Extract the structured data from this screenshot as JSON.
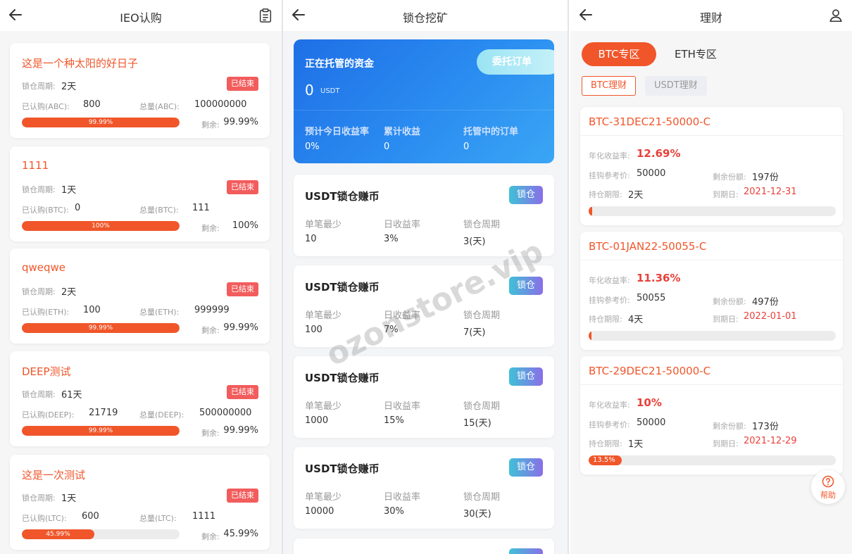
{
  "panel1": {
    "title": "IEO认购",
    "cards": [
      {
        "name": "这是一个种太阳的好日子",
        "period_label": "锁仓周期:",
        "period": "2天",
        "badge": "已结束",
        "subscribed_label": "已认购(ABC):",
        "subscribed": "800",
        "total_label": "总量(ABC):",
        "total": "100000000",
        "progress": 99.99,
        "progress_text": "99.99%",
        "remain_label": "剩余:",
        "remain": "99.99%"
      },
      {
        "name": "1111",
        "period_label": "锁仓周期:",
        "period": "1天",
        "badge": "已结束",
        "subscribed_label": "已认购(BTC):",
        "subscribed": "0",
        "total_label": "总量(BTC):",
        "total": "111",
        "progress": 100,
        "progress_text": "100%",
        "remain_label": "剩余:",
        "remain": "100%"
      },
      {
        "name": "qweqwe",
        "period_label": "锁仓周期:",
        "period": "2天",
        "badge": "已结束",
        "subscribed_label": "已认购(ETH):",
        "subscribed": "100",
        "total_label": "总量(ETH):",
        "total": "999999",
        "progress": 99.99,
        "progress_text": "99.99%",
        "remain_label": "剩余:",
        "remain": "99.99%"
      },
      {
        "name": "DEEP测试",
        "period_label": "锁仓周期:",
        "period": "61天",
        "badge": "已结束",
        "subscribed_label": "已认购(DEEP):",
        "subscribed": "21719",
        "total_label": "总量(DEEP):",
        "total": "500000000",
        "progress": 99.99,
        "progress_text": "99.99%",
        "remain_label": "剩余:",
        "remain": "99.99%"
      },
      {
        "name": "这是一次测试",
        "period_label": "锁仓周期:",
        "period": "1天",
        "badge": "已结束",
        "subscribed_label": "已认购(LTC):",
        "subscribed": "600",
        "total_label": "总量(LTC):",
        "total": "1111",
        "progress": 45.99,
        "progress_text": "45.99%",
        "remain_label": "剩余:",
        "remain": "45.99%"
      }
    ]
  },
  "panel2": {
    "title": "锁仓挖矿",
    "hero": {
      "label": "正在托管的资金",
      "amount": "0",
      "unit": "USDT",
      "entrust_button": "委托订单",
      "stats": [
        {
          "label": "预计今日收益率",
          "value": "0%"
        },
        {
          "label": "累计收益",
          "value": "0"
        },
        {
          "label": "托管中的订单",
          "value": "0"
        }
      ]
    },
    "cards": [
      {
        "title": "USDT锁仓赚币",
        "button": "锁仓",
        "min_label": "单笔最少",
        "min": "10",
        "rate_label": "日收益率",
        "rate": "3%",
        "period_label": "锁仓周期",
        "period": "3(天)"
      },
      {
        "title": "USDT锁仓赚币",
        "button": "锁仓",
        "min_label": "单笔最少",
        "min": "100",
        "rate_label": "日收益率",
        "rate": "7%",
        "period_label": "锁仓周期",
        "period": "7(天)"
      },
      {
        "title": "USDT锁仓赚币",
        "button": "锁仓",
        "min_label": "单笔最少",
        "min": "1000",
        "rate_label": "日收益率",
        "rate": "15%",
        "period_label": "锁仓周期",
        "period": "15(天)"
      },
      {
        "title": "USDT锁仓赚币",
        "button": "锁仓",
        "min_label": "单笔最少",
        "min": "10000",
        "rate_label": "日收益率",
        "rate": "30%",
        "period_label": "锁仓周期",
        "period": "30(天)"
      }
    ],
    "watermark": "ozonstore.vip"
  },
  "panel3": {
    "title": "理财",
    "zone_tabs": [
      "BTC专区",
      "ETH专区"
    ],
    "sub_tabs": [
      "BTC理财",
      "USDT理财"
    ],
    "cards": [
      {
        "title": "BTC-31DEC21-50000-C",
        "rate_label": "年化收益率:",
        "rate": "12.69%",
        "ref_label": "挂钩参考价:",
        "ref": "50000",
        "shares_label": "剩余份额:",
        "shares": "197份",
        "hold_label": "持仓期限:",
        "hold": "2天",
        "due_label": "到期日:",
        "due": "2021-12-31",
        "progress": 1.5,
        "progress_text": ""
      },
      {
        "title": "BTC-01JAN22-50055-C",
        "rate_label": "年化收益率:",
        "rate": "11.36%",
        "ref_label": "挂钩参考价:",
        "ref": "50055",
        "shares_label": "剩余份额:",
        "shares": "497份",
        "hold_label": "持仓期限:",
        "hold": "4天",
        "due_label": "到期日:",
        "due": "2022-01-01",
        "progress": 0.6,
        "progress_text": ""
      },
      {
        "title": "BTC-29DEC21-50000-C",
        "rate_label": "年化收益率:",
        "rate": "10%",
        "ref_label": "挂钩参考价:",
        "ref": "50000",
        "shares_label": "剩余份额:",
        "shares": "173份",
        "hold_label": "持仓期限:",
        "hold": "1天",
        "due_label": "到期日:",
        "due": "2021-12-29",
        "progress": 13.5,
        "progress_text": "13.5%"
      }
    ],
    "help_label": "帮助"
  },
  "icons": {
    "back": "arrow-left-icon",
    "orders": "clipboard-icon",
    "user": "user-icon",
    "help": "question-circle-icon"
  },
  "colors": {
    "accent": "#f0562a",
    "badge": "#f25c5c",
    "hero_blue": "#1f6fe6",
    "rate_red": "#e8403a"
  }
}
